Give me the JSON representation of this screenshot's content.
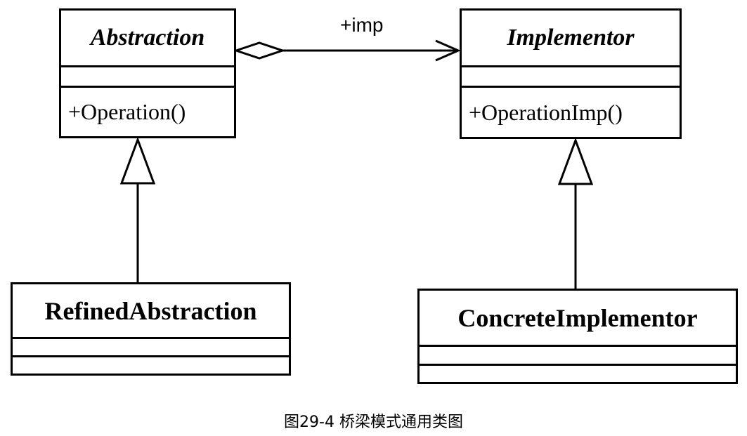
{
  "diagram": {
    "classes": {
      "abstraction": {
        "name": "Abstraction",
        "abstract": true,
        "attributes": [],
        "operations": [
          "+Operation()"
        ]
      },
      "implementor": {
        "name": "Implementor",
        "abstract": true,
        "attributes": [],
        "operations": [
          "+OperationImp()"
        ]
      },
      "refined": {
        "name": "RefinedAbstraction",
        "abstract": false,
        "attributes": [],
        "operations": []
      },
      "concrete": {
        "name": "ConcreteImplementor",
        "abstract": false,
        "attributes": [],
        "operations": []
      }
    },
    "relationships": [
      {
        "type": "aggregation",
        "from": "Abstraction",
        "to": "Implementor",
        "label": "+imp"
      },
      {
        "type": "generalization",
        "from": "RefinedAbstraction",
        "to": "Abstraction"
      },
      {
        "type": "generalization",
        "from": "ConcreteImplementor",
        "to": "Implementor"
      }
    ],
    "assoc_label": "+imp"
  },
  "caption": "图29-4 桥梁模式通用类图"
}
